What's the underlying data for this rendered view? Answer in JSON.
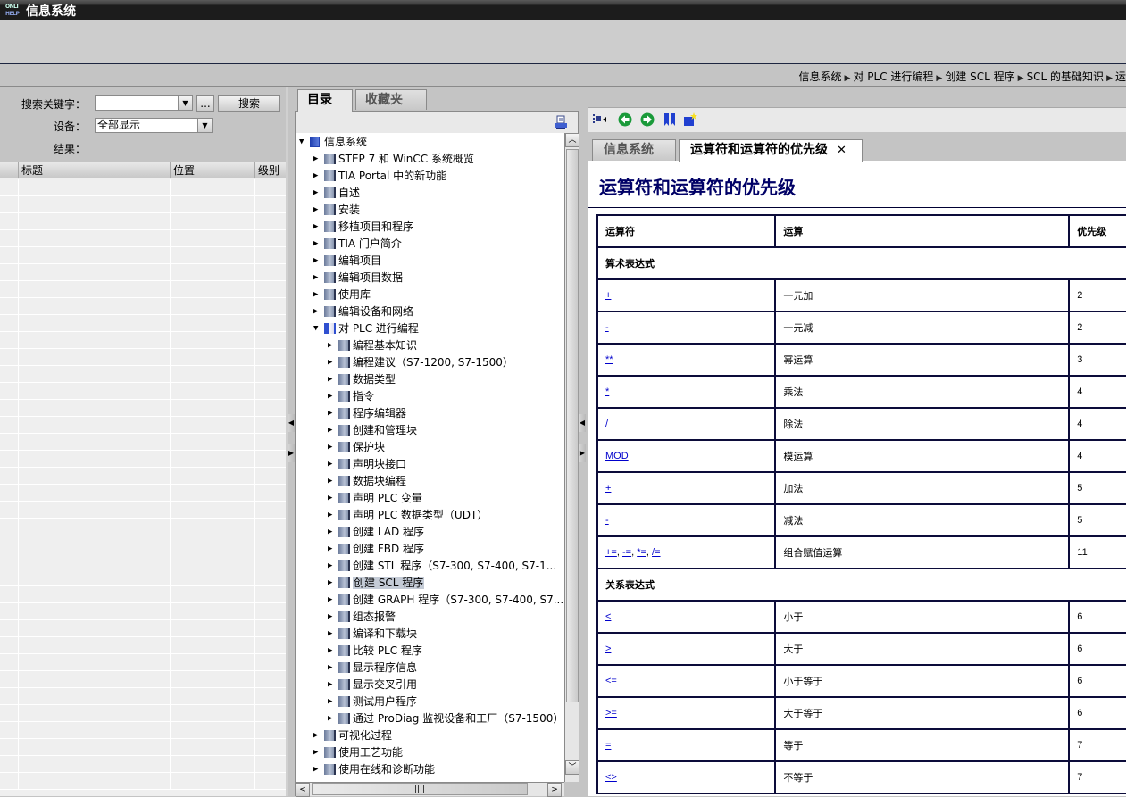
{
  "window": {
    "title": "信息系统",
    "logo_top": "ONLI",
    "logo_bottom": "HELP"
  },
  "breadcrumb": [
    "信息系统",
    "对 PLC 进行编程",
    "创建 SCL 程序",
    "SCL 的基础知识",
    "运"
  ],
  "search": {
    "keyword_label": "搜索关键字：",
    "keyword_value": "",
    "more_button": "...",
    "search_button": "搜索",
    "device_label": "设备：",
    "device_value": "全部显示",
    "result_label": "结果：",
    "columns": [
      "标题",
      "位置",
      "级别"
    ]
  },
  "toc": {
    "tabs": [
      {
        "label": "目录",
        "active": true
      },
      {
        "label": "收藏夹",
        "active": false
      }
    ],
    "items": [
      {
        "label": "信息系统",
        "level": 0,
        "expanded": true,
        "icon": "toc-root-icon"
      },
      {
        "label": "STEP 7 和 WinCC 系统概览",
        "level": 1
      },
      {
        "label": "TIA Portal 中的新功能",
        "level": 1
      },
      {
        "label": "自述",
        "level": 1
      },
      {
        "label": "安装",
        "level": 1
      },
      {
        "label": "移植项目和程序",
        "level": 1
      },
      {
        "label": "TIA 门户简介",
        "level": 1
      },
      {
        "label": "编辑项目",
        "level": 1
      },
      {
        "label": "编辑项目数据",
        "level": 1
      },
      {
        "label": "使用库",
        "level": 1
      },
      {
        "label": "编辑设备和网络",
        "level": 1
      },
      {
        "label": "对 PLC 进行编程",
        "level": 1,
        "expanded": true,
        "icon": "open-book-icon"
      },
      {
        "label": "编程基本知识",
        "level": 2
      },
      {
        "label": "编程建议（S7-1200, S7-1500）",
        "level": 2
      },
      {
        "label": "数据类型",
        "level": 2
      },
      {
        "label": "指令",
        "level": 2
      },
      {
        "label": "程序编辑器",
        "level": 2
      },
      {
        "label": "创建和管理块",
        "level": 2
      },
      {
        "label": "保护块",
        "level": 2
      },
      {
        "label": "声明块接口",
        "level": 2
      },
      {
        "label": "数据块编程",
        "level": 2
      },
      {
        "label": "声明 PLC 变量",
        "level": 2
      },
      {
        "label": "声明 PLC 数据类型（UDT）",
        "level": 2
      },
      {
        "label": "创建 LAD 程序",
        "level": 2
      },
      {
        "label": "创建 FBD 程序",
        "level": 2
      },
      {
        "label": "创建 STL 程序（S7-300, S7-400, S7-1...",
        "level": 2
      },
      {
        "label": "创建 SCL 程序",
        "level": 2,
        "selected": true
      },
      {
        "label": "创建 GRAPH 程序（S7-300, S7-400, S7...",
        "level": 2
      },
      {
        "label": "组态报警",
        "level": 2
      },
      {
        "label": "编译和下载块",
        "level": 2
      },
      {
        "label": "比较 PLC 程序",
        "level": 2
      },
      {
        "label": "显示程序信息",
        "level": 2
      },
      {
        "label": "显示交叉引用",
        "level": 2
      },
      {
        "label": "测试用户程序",
        "level": 2
      },
      {
        "label": "通过 ProDiag 监视设备和工厂（S7-1500）",
        "level": 2
      },
      {
        "label": "可视化过程",
        "level": 1
      },
      {
        "label": "使用工艺功能",
        "level": 1
      },
      {
        "label": "使用在线和诊断功能",
        "level": 1
      }
    ]
  },
  "content": {
    "tabs": [
      {
        "label": "信息系统",
        "active": false
      },
      {
        "label": "运算符和运算符的优先级",
        "active": true,
        "closable": true
      }
    ],
    "close_glyph": "✕",
    "heading": "运算符和运算符的优先级",
    "table": {
      "headers": [
        "运算符",
        "运算",
        "优先级"
      ],
      "sections": [
        {
          "group": "算术表达式",
          "rows": [
            {
              "op": [
                "+"
              ],
              "name": "一元加",
              "prio": "2"
            },
            {
              "op": [
                "-"
              ],
              "name": "一元减",
              "prio": "2"
            },
            {
              "op": [
                "**"
              ],
              "name": "幂运算",
              "prio": "3"
            },
            {
              "op": [
                "*"
              ],
              "name": "乘法",
              "prio": "4"
            },
            {
              "op": [
                "/"
              ],
              "name": "除法",
              "prio": "4"
            },
            {
              "op": [
                "MOD"
              ],
              "name": "模运算",
              "prio": "4"
            },
            {
              "op": [
                "+"
              ],
              "name": "加法",
              "prio": "5"
            },
            {
              "op": [
                "-"
              ],
              "name": "减法",
              "prio": "5"
            },
            {
              "op": [
                "+=",
                "-=",
                "*=",
                "/="
              ],
              "name": "组合赋值运算",
              "prio": "11"
            }
          ]
        },
        {
          "group": "关系表达式",
          "rows": [
            {
              "op": [
                "<"
              ],
              "name": "小于",
              "prio": "6"
            },
            {
              "op": [
                ">"
              ],
              "name": "大于",
              "prio": "6"
            },
            {
              "op": [
                "<="
              ],
              "name": "小于等于",
              "prio": "6"
            },
            {
              "op": [
                ">="
              ],
              "name": "大于等于",
              "prio": "6"
            },
            {
              "op": [
                "="
              ],
              "name": "等于",
              "prio": "7"
            },
            {
              "op": [
                "<>"
              ],
              "name": "不等于",
              "prio": "7"
            }
          ]
        }
      ]
    }
  },
  "colors": {
    "heading": "#000066",
    "link": "#0000cc",
    "selection": "#c4cbd6",
    "table_border": "#0c0c3a"
  }
}
